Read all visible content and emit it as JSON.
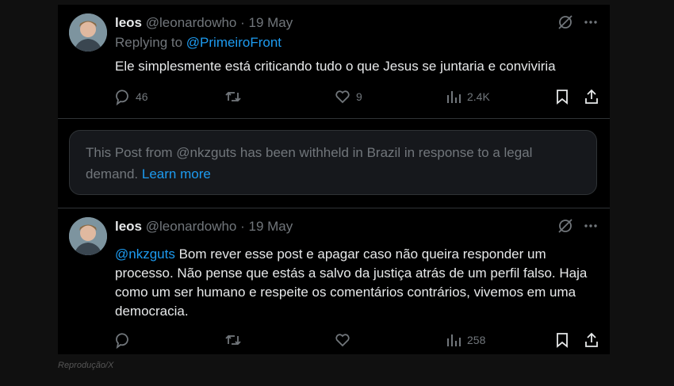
{
  "posts": [
    {
      "name": "leos",
      "handle": "@leonardowho",
      "sep": "·",
      "date": "19 May",
      "replying_label": "Replying to ",
      "replying_to": "@PrimeiroFront",
      "text": "Ele simplesmente está criticando tudo o que Jesus se juntaria e conviviria",
      "replies": "46",
      "likes": "9",
      "views": "2.4K"
    },
    {
      "name": "leos",
      "handle": "@leonardowho",
      "sep": "·",
      "date": "19 May",
      "mention": "@nkzguts",
      "text": " Bom rever esse post e apagar caso não queira responder um processo. Não pense que estás a salvo da justiça atrás de um perfil falso. Haja como um ser humano e respeite os comentários contrários, vivemos em uma democracia.",
      "views": "258"
    }
  ],
  "withheld": {
    "text": "This Post from @nkzguts has been withheld in Brazil in response to a legal demand. ",
    "link": "Learn more"
  },
  "credit": "Reprodução/X",
  "icons": {
    "grok": "grok-icon",
    "more": "more-icon",
    "reply": "reply-icon",
    "repost": "repost-icon",
    "like": "like-icon",
    "views": "views-icon",
    "bookmark": "bookmark-icon",
    "share": "share-icon"
  },
  "colors": {
    "link": "#1d9bf0",
    "muted": "#71767b",
    "text": "#e7e9ea",
    "background": "#000000"
  }
}
